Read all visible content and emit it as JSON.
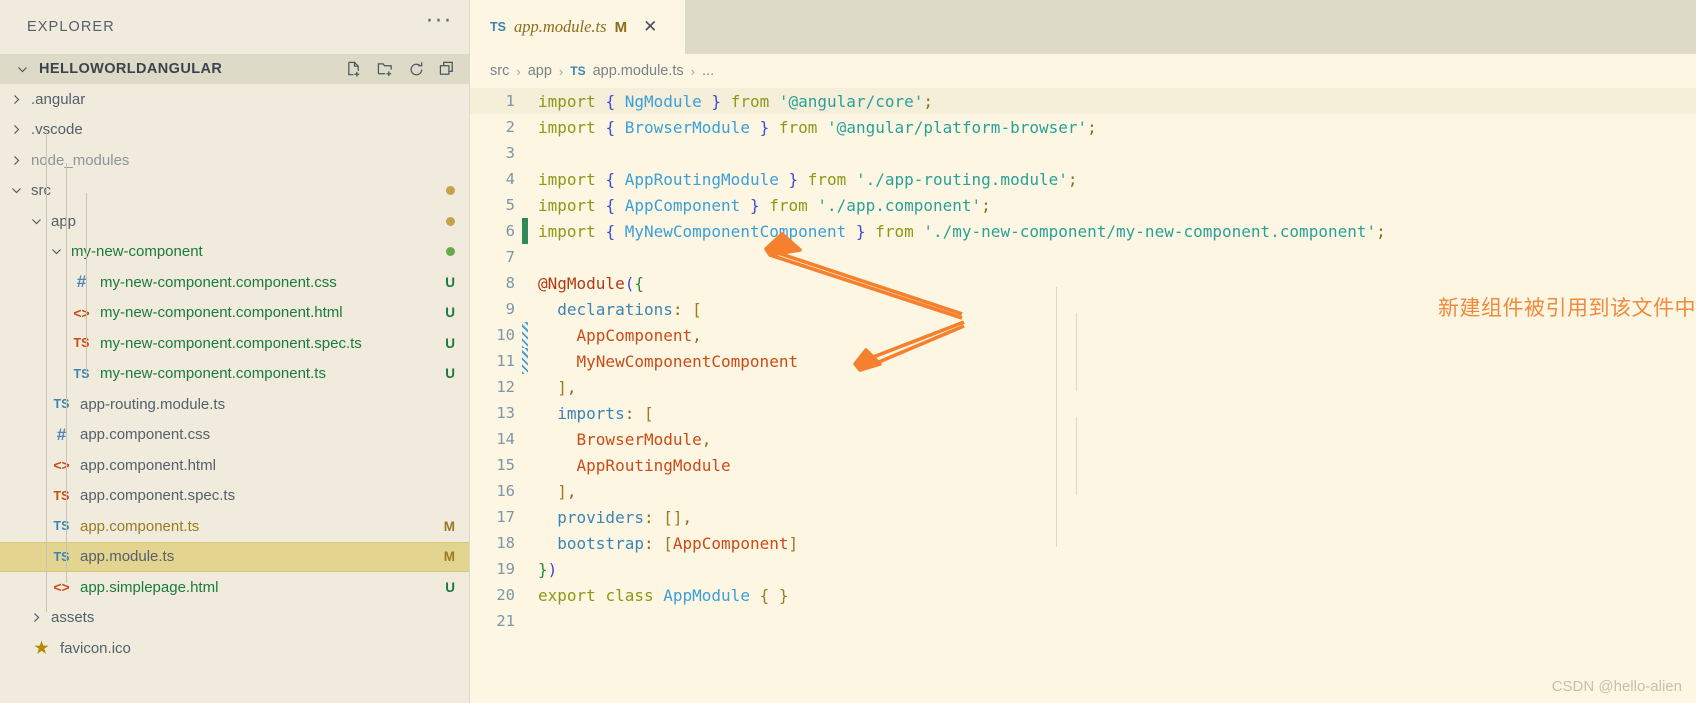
{
  "sidebar": {
    "title": "EXPLORER",
    "more_label": "···",
    "root": {
      "name": "HELLOWORLDANGULAR",
      "actions": [
        {
          "name": "new-file-icon",
          "label": "New File"
        },
        {
          "name": "new-folder-icon",
          "label": "New Folder"
        },
        {
          "name": "refresh-icon",
          "label": "Refresh Explorer"
        },
        {
          "name": "collapse-all-icon",
          "label": "Collapse Folders in Explorer"
        }
      ]
    },
    "items": [
      {
        "label": ".angular",
        "kind": "folder",
        "indent": 1,
        "expanded": false,
        "status": "",
        "state": "normal"
      },
      {
        "label": ".vscode",
        "kind": "folder",
        "indent": 1,
        "expanded": false,
        "status": "",
        "state": "normal"
      },
      {
        "label": "node_modules",
        "kind": "folder",
        "indent": 1,
        "expanded": false,
        "status": "",
        "state": "dim"
      },
      {
        "label": "src",
        "kind": "folder",
        "indent": 1,
        "expanded": true,
        "status": "dot-amber",
        "state": "normal"
      },
      {
        "label": "app",
        "kind": "folder",
        "indent": 2,
        "expanded": true,
        "status": "dot-amber",
        "state": "normal"
      },
      {
        "label": "my-new-component",
        "kind": "folder",
        "indent": 3,
        "expanded": true,
        "status": "dot-green",
        "state": "new"
      },
      {
        "label": "my-new-component.component.css",
        "kind": "css",
        "indent": 4,
        "status": "U",
        "state": "new"
      },
      {
        "label": "my-new-component.component.html",
        "kind": "html",
        "indent": 4,
        "status": "U",
        "state": "new"
      },
      {
        "label": "my-new-component.component.spec.ts",
        "kind": "ts-red",
        "indent": 4,
        "status": "U",
        "state": "new"
      },
      {
        "label": "my-new-component.component.ts",
        "kind": "ts",
        "indent": 4,
        "status": "U",
        "state": "new"
      },
      {
        "label": "app-routing.module.ts",
        "kind": "ts",
        "indent": 3,
        "status": "",
        "state": "normal"
      },
      {
        "label": "app.component.css",
        "kind": "css",
        "indent": 3,
        "status": "",
        "state": "normal"
      },
      {
        "label": "app.component.html",
        "kind": "html",
        "indent": 3,
        "status": "",
        "state": "normal"
      },
      {
        "label": "app.component.spec.ts",
        "kind": "ts-red",
        "indent": 3,
        "status": "",
        "state": "normal"
      },
      {
        "label": "app.component.ts",
        "kind": "ts",
        "indent": 3,
        "status": "M",
        "state": "mod"
      },
      {
        "label": "app.module.ts",
        "kind": "ts",
        "indent": 3,
        "status": "M",
        "state": "normal",
        "selected": true
      },
      {
        "label": "app.simplepage.html",
        "kind": "html",
        "indent": 3,
        "status": "U",
        "state": "new"
      },
      {
        "label": "assets",
        "kind": "folder",
        "indent": 2,
        "expanded": false,
        "status": "",
        "state": "normal"
      },
      {
        "label": "favicon.ico",
        "kind": "star",
        "indent": 2,
        "status": "",
        "state": "normal"
      }
    ]
  },
  "editor": {
    "tab": {
      "icon_label": "TS",
      "title": "app.module.ts",
      "dirty": "M",
      "close": "✕"
    },
    "breadcrumb": [
      "src",
      "app",
      "app.module.ts",
      "..."
    ],
    "breadcrumb_icon": "TS",
    "current_line": 1,
    "lines": [
      {
        "n": 1,
        "gutter": "",
        "tokens": [
          {
            "t": "import",
            "c": "k"
          },
          {
            "t": " ",
            "c": ""
          },
          {
            "t": "{",
            "c": "br"
          },
          {
            "t": " ",
            "c": ""
          },
          {
            "t": "NgModule",
            "c": "cls"
          },
          {
            "t": " ",
            "c": ""
          },
          {
            "t": "}",
            "c": "br"
          },
          {
            "t": " ",
            "c": ""
          },
          {
            "t": "from",
            "c": "k"
          },
          {
            "t": " ",
            "c": ""
          },
          {
            "t": "'@angular/core'",
            "c": "str"
          },
          {
            "t": ";",
            "c": "pun"
          }
        ]
      },
      {
        "n": 2,
        "gutter": "",
        "tokens": [
          {
            "t": "import",
            "c": "k"
          },
          {
            "t": " ",
            "c": ""
          },
          {
            "t": "{",
            "c": "br"
          },
          {
            "t": " ",
            "c": ""
          },
          {
            "t": "BrowserModule",
            "c": "cls"
          },
          {
            "t": " ",
            "c": ""
          },
          {
            "t": "}",
            "c": "br"
          },
          {
            "t": " ",
            "c": ""
          },
          {
            "t": "from",
            "c": "k"
          },
          {
            "t": " ",
            "c": ""
          },
          {
            "t": "'@angular/platform-browser'",
            "c": "str"
          },
          {
            "t": ";",
            "c": "pun"
          }
        ]
      },
      {
        "n": 3,
        "gutter": "",
        "tokens": []
      },
      {
        "n": 4,
        "gutter": "",
        "tokens": [
          {
            "t": "import",
            "c": "k"
          },
          {
            "t": " ",
            "c": ""
          },
          {
            "t": "{",
            "c": "br"
          },
          {
            "t": " ",
            "c": ""
          },
          {
            "t": "AppRoutingModule",
            "c": "cls"
          },
          {
            "t": " ",
            "c": ""
          },
          {
            "t": "}",
            "c": "br"
          },
          {
            "t": " ",
            "c": ""
          },
          {
            "t": "from",
            "c": "k"
          },
          {
            "t": " ",
            "c": ""
          },
          {
            "t": "'./app-routing.module'",
            "c": "str"
          },
          {
            "t": ";",
            "c": "pun"
          }
        ]
      },
      {
        "n": 5,
        "gutter": "",
        "tokens": [
          {
            "t": "import",
            "c": "k"
          },
          {
            "t": " ",
            "c": ""
          },
          {
            "t": "{",
            "c": "br"
          },
          {
            "t": " ",
            "c": ""
          },
          {
            "t": "AppComponent",
            "c": "cls"
          },
          {
            "t": " ",
            "c": ""
          },
          {
            "t": "}",
            "c": "br"
          },
          {
            "t": " ",
            "c": ""
          },
          {
            "t": "from",
            "c": "k"
          },
          {
            "t": " ",
            "c": ""
          },
          {
            "t": "'./app.component'",
            "c": "str"
          },
          {
            "t": ";",
            "c": "pun"
          }
        ]
      },
      {
        "n": 6,
        "gutter": "added",
        "tokens": [
          {
            "t": "import",
            "c": "k"
          },
          {
            "t": " ",
            "c": ""
          },
          {
            "t": "{",
            "c": "br"
          },
          {
            "t": " ",
            "c": ""
          },
          {
            "t": "MyNewComponentComponent",
            "c": "cls"
          },
          {
            "t": " ",
            "c": ""
          },
          {
            "t": "}",
            "c": "br"
          },
          {
            "t": " ",
            "c": ""
          },
          {
            "t": "from",
            "c": "k"
          },
          {
            "t": " ",
            "c": ""
          },
          {
            "t": "'./my-new-component/my-new-component.component'",
            "c": "str"
          },
          {
            "t": ";",
            "c": "pun"
          }
        ]
      },
      {
        "n": 7,
        "gutter": "",
        "tokens": []
      },
      {
        "n": 8,
        "gutter": "",
        "tokens": [
          {
            "t": "@NgModule",
            "c": "dec"
          },
          {
            "t": "(",
            "c": "br"
          },
          {
            "t": "{",
            "c": "grn"
          }
        ]
      },
      {
        "n": 9,
        "gutter": "",
        "tokens": [
          {
            "t": "  ",
            "c": ""
          },
          {
            "t": "declarations",
            "c": "prop"
          },
          {
            "t": ":",
            "c": "pun"
          },
          {
            "t": " ",
            "c": ""
          },
          {
            "t": "[",
            "c": "brk"
          }
        ]
      },
      {
        "n": 10,
        "gutter": "modified",
        "tokens": [
          {
            "t": "    ",
            "c": ""
          },
          {
            "t": "AppComponent",
            "c": "ident"
          },
          {
            "t": ",",
            "c": "pun"
          }
        ]
      },
      {
        "n": 11,
        "gutter": "modified",
        "tokens": [
          {
            "t": "    ",
            "c": ""
          },
          {
            "t": "MyNewComponentComponent",
            "c": "ident"
          }
        ]
      },
      {
        "n": 12,
        "gutter": "",
        "tokens": [
          {
            "t": "  ",
            "c": ""
          },
          {
            "t": "]",
            "c": "brk"
          },
          {
            "t": ",",
            "c": "pun"
          }
        ]
      },
      {
        "n": 13,
        "gutter": "",
        "tokens": [
          {
            "t": "  ",
            "c": ""
          },
          {
            "t": "imports",
            "c": "prop"
          },
          {
            "t": ":",
            "c": "pun"
          },
          {
            "t": " ",
            "c": ""
          },
          {
            "t": "[",
            "c": "brk"
          }
        ]
      },
      {
        "n": 14,
        "gutter": "",
        "tokens": [
          {
            "t": "    ",
            "c": ""
          },
          {
            "t": "BrowserModule",
            "c": "ident"
          },
          {
            "t": ",",
            "c": "pun"
          }
        ]
      },
      {
        "n": 15,
        "gutter": "",
        "tokens": [
          {
            "t": "    ",
            "c": ""
          },
          {
            "t": "AppRoutingModule",
            "c": "ident"
          }
        ]
      },
      {
        "n": 16,
        "gutter": "",
        "tokens": [
          {
            "t": "  ",
            "c": ""
          },
          {
            "t": "]",
            "c": "brk"
          },
          {
            "t": ",",
            "c": "pun"
          }
        ]
      },
      {
        "n": 17,
        "gutter": "",
        "tokens": [
          {
            "t": "  ",
            "c": ""
          },
          {
            "t": "providers",
            "c": "prop"
          },
          {
            "t": ":",
            "c": "pun"
          },
          {
            "t": " ",
            "c": ""
          },
          {
            "t": "[]",
            "c": "brk"
          },
          {
            "t": ",",
            "c": "pun"
          }
        ]
      },
      {
        "n": 18,
        "gutter": "",
        "tokens": [
          {
            "t": "  ",
            "c": ""
          },
          {
            "t": "bootstrap",
            "c": "prop"
          },
          {
            "t": ":",
            "c": "pun"
          },
          {
            "t": " ",
            "c": ""
          },
          {
            "t": "[",
            "c": "brk"
          },
          {
            "t": "AppComponent",
            "c": "ident"
          },
          {
            "t": "]",
            "c": "brk"
          }
        ]
      },
      {
        "n": 19,
        "gutter": "",
        "tokens": [
          {
            "t": "}",
            "c": "grn"
          },
          {
            "t": ")",
            "c": "br"
          }
        ]
      },
      {
        "n": 20,
        "gutter": "",
        "tokens": [
          {
            "t": "export",
            "c": "k"
          },
          {
            "t": " ",
            "c": ""
          },
          {
            "t": "class",
            "c": "k"
          },
          {
            "t": " ",
            "c": ""
          },
          {
            "t": "AppModule",
            "c": "cls"
          },
          {
            "t": " ",
            "c": ""
          },
          {
            "t": "{",
            "c": "brk"
          },
          {
            "t": " ",
            "c": ""
          },
          {
            "t": "}",
            "c": "brk"
          }
        ]
      },
      {
        "n": 21,
        "gutter": "",
        "tokens": []
      }
    ]
  },
  "annotation": {
    "text": "新建组件被引用到该文件中",
    "color": "#f08a3c"
  },
  "watermark": "CSDN @hello-alien"
}
